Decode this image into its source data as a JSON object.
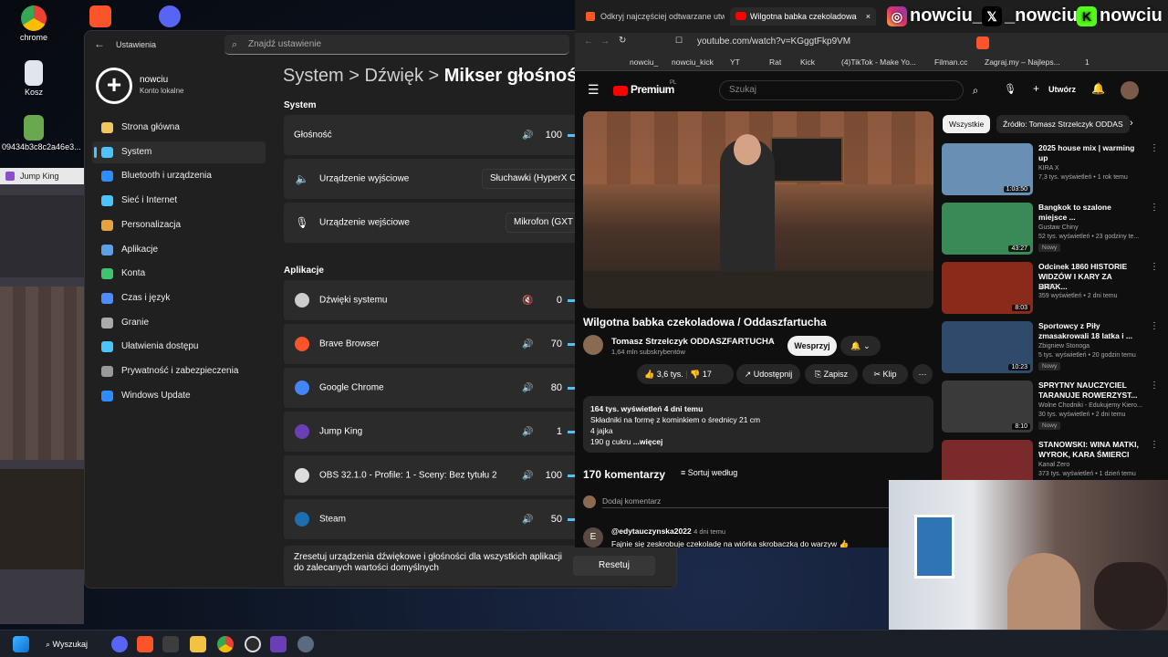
{
  "desktop": {
    "icons": [
      {
        "label": "chrome"
      },
      {
        "label": "Kosz"
      },
      {
        "label": "09434b3c8c2a46e3..."
      }
    ]
  },
  "jumpking": {
    "title": "Jump King"
  },
  "settings": {
    "window_title": "Ustawienia",
    "search_placeholder": "Znajdź ustawienie",
    "profile": {
      "name": "nowciu",
      "sub": "Konto lokalne"
    },
    "nav": [
      {
        "label": "Strona główna",
        "icon": "home-icon",
        "color": "#f0c75e"
      },
      {
        "label": "System",
        "icon": "system-icon",
        "color": "#4cc2ff"
      },
      {
        "label": "Bluetooth i urządzenia",
        "icon": "bluetooth-icon",
        "color": "#2f8cff"
      },
      {
        "label": "Sieć i Internet",
        "icon": "wifi-icon",
        "color": "#4cc2ff"
      },
      {
        "label": "Personalizacja",
        "icon": "brush-icon",
        "color": "#e6a23c"
      },
      {
        "label": "Aplikacje",
        "icon": "apps-icon",
        "color": "#5ea0e8"
      },
      {
        "label": "Konta",
        "icon": "account-icon",
        "color": "#3ec46d"
      },
      {
        "label": "Czas i język",
        "icon": "clock-icon",
        "color": "#4c8cff"
      },
      {
        "label": "Granie",
        "icon": "gamepad-icon",
        "color": "#aaaaaa"
      },
      {
        "label": "Ułatwienia dostępu",
        "icon": "accessibility-icon",
        "color": "#4cc2ff"
      },
      {
        "label": "Prywatność i zabezpieczenia",
        "icon": "shield-icon",
        "color": "#999999"
      },
      {
        "label": "Windows Update",
        "icon": "update-icon",
        "color": "#2f8cff"
      }
    ],
    "breadcrumb": {
      "a": "System",
      "sep1": ">",
      "b": "Dźwięk",
      "sep2": ">",
      "c": "Mikser głośności"
    },
    "system_section": "System",
    "volume_label": "Głośność",
    "volume_value": "100",
    "output_label": "Urządzenie wyjściowe",
    "output_value": "Słuchawki (HyperX Cloud",
    "input_label": "Urządzenie wejściowe",
    "input_value": "Mikrofon (GXT 256",
    "apps_section": "Aplikacje",
    "apps": [
      {
        "name": "Dźwięki systemu",
        "volume": "0",
        "muted": true
      },
      {
        "name": "Brave Browser",
        "volume": "70"
      },
      {
        "name": "Google Chrome",
        "volume": "80"
      },
      {
        "name": "Jump King",
        "volume": "1"
      },
      {
        "name": "OBS 32.1.0 - Profile: 1 - Sceny: Bez tytułu 2",
        "volume": "100"
      },
      {
        "name": "Steam",
        "volume": "50"
      }
    ],
    "reset_text": "Zresetuj urządzenia dźwiękowe i głośności dla wszystkich aplikacji do zalecanych wartości domyślnych",
    "reset_button": "Resetuj"
  },
  "browser": {
    "tabs": [
      {
        "label": "Odkryj najczęściej odtwarzane utwor"
      },
      {
        "label": "Wilgotna babka czekoladowa",
        "active": true
      }
    ],
    "tab_close": "×",
    "url": "youtube.com/watch?v=KGggtFkp9VM",
    "bookmarks": [
      "nowciu_",
      "nowciu_kick",
      "YT",
      "Rat",
      "Kick",
      "(4)TikTok - Make Yo...",
      "Filman.cc",
      "Zagraj.my – Najleps...",
      "1"
    ]
  },
  "youtube": {
    "logo": "Premium",
    "logo_sup": "PL",
    "search_placeholder": "Szukaj",
    "create_label": "Utwórz",
    "video_title": "Wilgotna babka czekoladowa / Oddaszfartucha",
    "channel": "Tomasz Strzelczyk ODDASZFARTUCHA",
    "subs": "1,64 mln subskrybentów",
    "support": "Wesprzyj",
    "likes": "3,6 tys.",
    "dislikes": "17",
    "share": "Udostępnij",
    "save": "Zapisz",
    "clip": "Klip",
    "desc_stats": "164 tys. wyświetleń  4 dni temu",
    "desc_line1": "Składniki na formę z kominkiem o średnicy 21 cm",
    "desc_line2": "4 jajka",
    "desc_line3": "190 g cukru",
    "desc_more": "...więcej",
    "comments_count": "170 komentarzy",
    "sort_label": "Sortuj według",
    "add_comment": "Dodaj komentarz",
    "comment_author": "@edytauczynska2022",
    "comment_time": "4 dni temu",
    "comment_text": "Fajnie się zeskrobuje czekoladę na wiórka skrobaczką do warzyw 👍",
    "chips": [
      "Wszystkie",
      "Źródło: Tomasz Strzelczyk ODDAS"
    ],
    "recs": [
      {
        "title": "2025 house mix | warming up",
        "channel": "KIRA X",
        "meta": "7,3 tys. wyświetleń • 1 rok temu",
        "duration": "1:03:50",
        "new": ""
      },
      {
        "title": "Bangkok to szalone miejsce ...",
        "channel": "Gustaw Chiny",
        "meta": "52 tys. wyświetleń • 23 godziny te...",
        "duration": "43:27",
        "new": "Nowy"
      },
      {
        "title": "Odcinek 1860 HISTORIE WIDZÓW I KARY ZA BRAK...",
        "channel": "DOBO",
        "meta": "359 wyświetleń • 2 dni temu",
        "duration": "8:03",
        "new": ""
      },
      {
        "title": "Sportowcy z Piły zmasakrowali 18 latka i ...",
        "channel": "Zbigniew Stonoga",
        "meta": "5 tys. wyświetleń • 20 godzin temu",
        "duration": "10:23",
        "new": "Nowy"
      },
      {
        "title": "SPRYTNY NAUCZYCIEL TARANUJE ROWERZYST...",
        "channel": "Wolne Chodniki - Edukujemy Kiero...",
        "meta": "30 tys. wyświetleń • 2 dni temu",
        "duration": "8:10",
        "new": "Nowy"
      },
      {
        "title": "STANOWSKI: WINA MATKI, WYROK, KARA ŚMIERCI",
        "channel": "Kanał Zero",
        "meta": "373 tys. wyświetleń • 1 dzień temu",
        "duration": "",
        "new": ""
      }
    ]
  },
  "social": {
    "instagram": "nowciu_",
    "x": "_nowciu",
    "kick": "nowciu"
  },
  "taskbar": {
    "search": "Wyszukaj"
  }
}
